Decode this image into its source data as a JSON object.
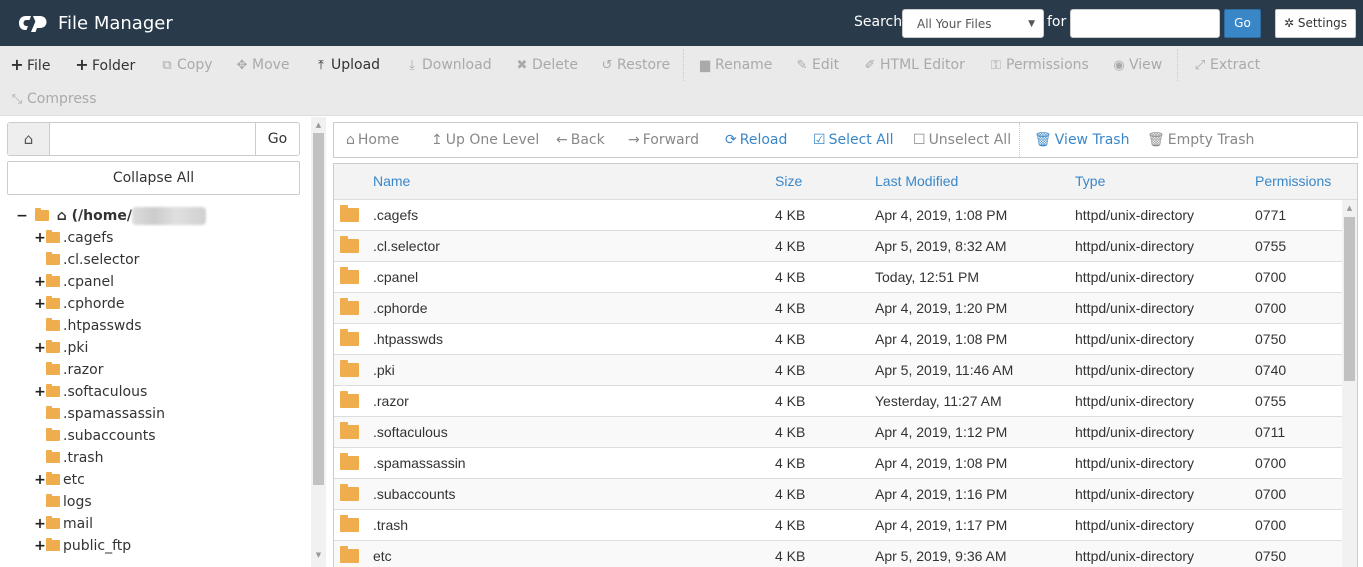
{
  "header": {
    "title": "File Manager",
    "search_label": "Search",
    "search_scope": "All Your Files",
    "for_label": "for",
    "search_value": "",
    "go_label": "Go",
    "settings_label": "Settings"
  },
  "toolbar": {
    "items": [
      {
        "label": "File",
        "icon": "plus-icon",
        "enabled": true
      },
      {
        "label": "Folder",
        "icon": "plus-icon",
        "enabled": true
      },
      {
        "label": "Copy",
        "icon": "copy-icon",
        "enabled": false
      },
      {
        "label": "Move",
        "icon": "move-icon",
        "enabled": false
      },
      {
        "label": "Upload",
        "icon": "upload-icon",
        "enabled": true
      },
      {
        "label": "Download",
        "icon": "download-icon",
        "enabled": false
      },
      {
        "label": "Delete",
        "icon": "close-icon",
        "enabled": false
      },
      {
        "label": "Restore",
        "icon": "undo-icon",
        "enabled": false
      },
      {
        "label": "Rename",
        "icon": "file-icon",
        "enabled": false
      },
      {
        "label": "Edit",
        "icon": "pencil-icon",
        "enabled": false
      },
      {
        "label": "HTML Editor",
        "icon": "edit-square-icon",
        "enabled": false
      },
      {
        "label": "Permissions",
        "icon": "key-icon",
        "enabled": false
      },
      {
        "label": "View",
        "icon": "eye-icon",
        "enabled": false
      },
      {
        "label": "Extract",
        "icon": "expand-icon",
        "enabled": false
      },
      {
        "label": "Compress",
        "icon": "compress-icon",
        "enabled": false
      }
    ]
  },
  "sidebar": {
    "path_value": "",
    "go_label": "Go",
    "collapse_label": "Collapse All",
    "root_label": "(/home/",
    "tree": [
      {
        "name": ".cagefs",
        "expandable": true
      },
      {
        "name": ".cl.selector",
        "expandable": false
      },
      {
        "name": ".cpanel",
        "expandable": true
      },
      {
        "name": ".cphorde",
        "expandable": true
      },
      {
        "name": ".htpasswds",
        "expandable": false
      },
      {
        "name": ".pki",
        "expandable": true
      },
      {
        "name": ".razor",
        "expandable": false
      },
      {
        "name": ".softaculous",
        "expandable": true
      },
      {
        "name": ".spamassassin",
        "expandable": false
      },
      {
        "name": ".subaccounts",
        "expandable": false
      },
      {
        "name": ".trash",
        "expandable": false
      },
      {
        "name": "etc",
        "expandable": true
      },
      {
        "name": "logs",
        "expandable": false
      },
      {
        "name": "mail",
        "expandable": true
      },
      {
        "name": "public_ftp",
        "expandable": true
      }
    ]
  },
  "navbar": {
    "items": [
      {
        "label": "Home",
        "icon": "home-icon",
        "enabled": false
      },
      {
        "label": "Up One Level",
        "icon": "level-up-icon",
        "enabled": false
      },
      {
        "label": "Back",
        "icon": "arrow-left-icon",
        "enabled": false
      },
      {
        "label": "Forward",
        "icon": "arrow-right-icon",
        "enabled": false
      },
      {
        "label": "Reload",
        "icon": "refresh-icon",
        "enabled": true
      },
      {
        "label": "Select All",
        "icon": "checkbox-checked-icon",
        "enabled": true
      },
      {
        "label": "Unselect All",
        "icon": "checkbox-empty-icon",
        "enabled": false
      },
      {
        "label": "View Trash",
        "icon": "trash-icon",
        "enabled": true
      },
      {
        "label": "Empty Trash",
        "icon": "trash-icon",
        "enabled": false
      }
    ]
  },
  "table": {
    "columns": [
      "Name",
      "Size",
      "Last Modified",
      "Type",
      "Permissions"
    ],
    "rows": [
      {
        "name": ".cagefs",
        "size": "4 KB",
        "modified": "Apr 4, 2019, 1:08 PM",
        "type": "httpd/unix-directory",
        "perms": "0771"
      },
      {
        "name": ".cl.selector",
        "size": "4 KB",
        "modified": "Apr 5, 2019, 8:32 AM",
        "type": "httpd/unix-directory",
        "perms": "0755"
      },
      {
        "name": ".cpanel",
        "size": "4 KB",
        "modified": "Today, 12:51 PM",
        "type": "httpd/unix-directory",
        "perms": "0700"
      },
      {
        "name": ".cphorde",
        "size": "4 KB",
        "modified": "Apr 4, 2019, 1:20 PM",
        "type": "httpd/unix-directory",
        "perms": "0700"
      },
      {
        "name": ".htpasswds",
        "size": "4 KB",
        "modified": "Apr 4, 2019, 1:08 PM",
        "type": "httpd/unix-directory",
        "perms": "0750"
      },
      {
        "name": ".pki",
        "size": "4 KB",
        "modified": "Apr 5, 2019, 11:46 AM",
        "type": "httpd/unix-directory",
        "perms": "0740"
      },
      {
        "name": ".razor",
        "size": "4 KB",
        "modified": "Yesterday, 11:27 AM",
        "type": "httpd/unix-directory",
        "perms": "0755"
      },
      {
        "name": ".softaculous",
        "size": "4 KB",
        "modified": "Apr 4, 2019, 1:12 PM",
        "type": "httpd/unix-directory",
        "perms": "0711"
      },
      {
        "name": ".spamassassin",
        "size": "4 KB",
        "modified": "Apr 4, 2019, 1:08 PM",
        "type": "httpd/unix-directory",
        "perms": "0700"
      },
      {
        "name": ".subaccounts",
        "size": "4 KB",
        "modified": "Apr 4, 2019, 1:16 PM",
        "type": "httpd/unix-directory",
        "perms": "0700"
      },
      {
        "name": ".trash",
        "size": "4 KB",
        "modified": "Apr 4, 2019, 1:17 PM",
        "type": "httpd/unix-directory",
        "perms": "0700"
      },
      {
        "name": "etc",
        "size": "4 KB",
        "modified": "Apr 5, 2019, 9:36 AM",
        "type": "httpd/unix-directory",
        "perms": "0750"
      }
    ]
  },
  "colors": {
    "header_bg": "#293a4a",
    "accent": "#3a87c8",
    "folder": "#f0ad4e",
    "toolbar_bg": "#eaeaea"
  }
}
